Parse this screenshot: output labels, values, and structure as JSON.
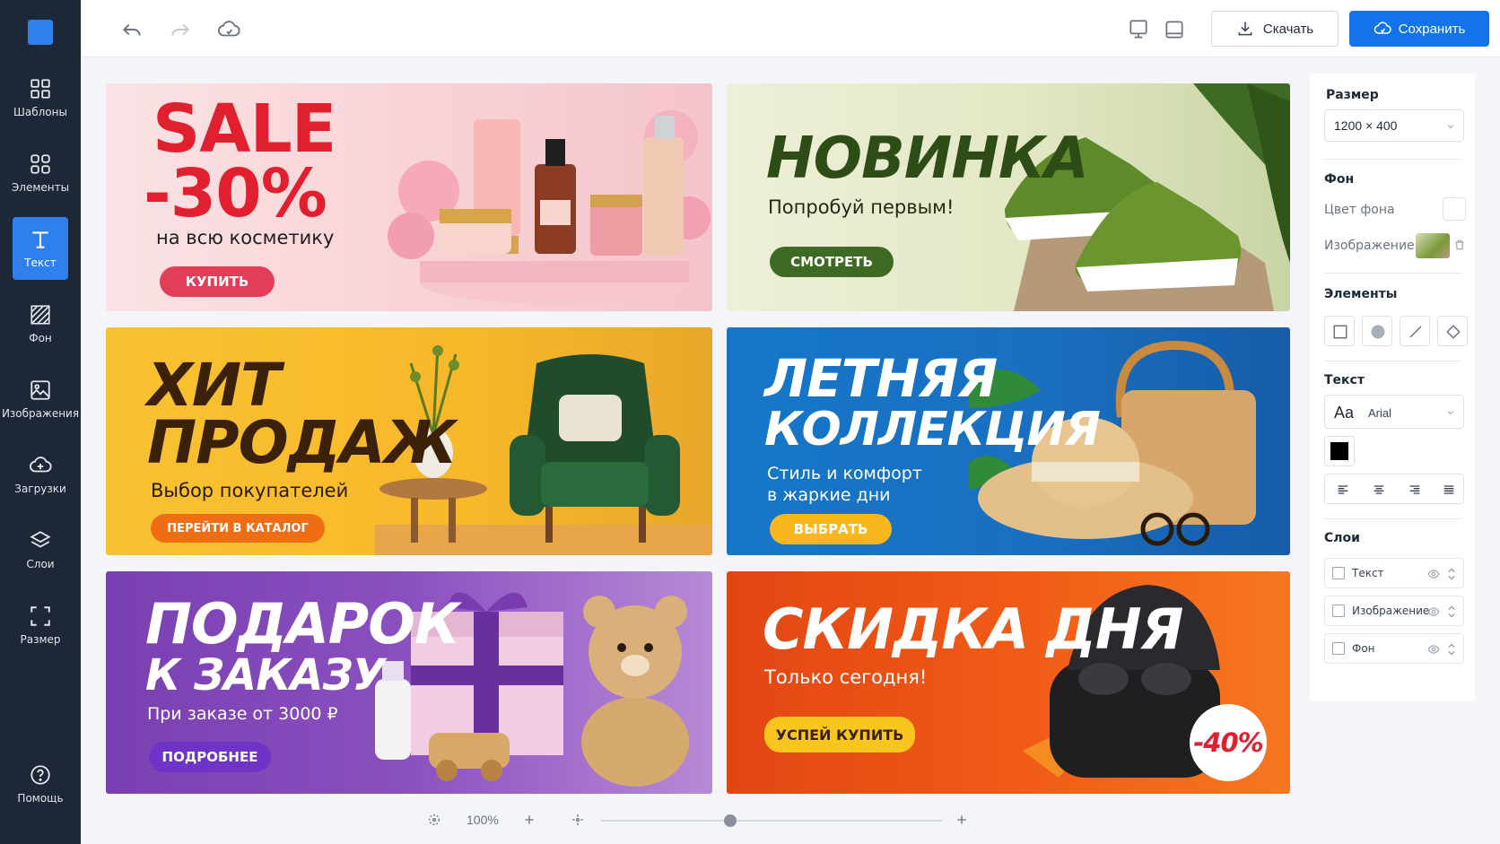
{
  "sidebar": {
    "items": [
      {
        "label": "Шаблоны",
        "icon": "grid-icon"
      },
      {
        "label": "Элементы",
        "icon": "shapes-icon"
      },
      {
        "label": "Текст",
        "icon": "text-icon"
      },
      {
        "label": "Фон",
        "icon": "background-icon"
      },
      {
        "label": "Изображения",
        "icon": "image-icon"
      },
      {
        "label": "Загрузки",
        "icon": "upload-icon"
      },
      {
        "label": "Слои",
        "icon": "layers-icon"
      },
      {
        "label": "Размер",
        "icon": "resize-icon"
      }
    ],
    "help": {
      "label": "Помощь",
      "icon": "help-icon"
    },
    "active_index": 2
  },
  "toolbar": {
    "download_label": "Скачать",
    "save_label": "Сохранить"
  },
  "banners": {
    "sale": {
      "title1": "SALE",
      "title2": "-30%",
      "subtitle": "на всю косметику",
      "button": "КУПИТЬ"
    },
    "new": {
      "title": "НОВИНКА",
      "subtitle": "Попробуй первым!",
      "button": "СМОТРЕТЬ"
    },
    "hit": {
      "title1": "ХИТ",
      "title2": "ПРОДАЖ",
      "subtitle": "Выбор покупателей",
      "button": "ПЕРЕЙТИ В КАТАЛОГ"
    },
    "summer": {
      "title1": "ЛЕТНЯЯ",
      "title2": "КОЛЛЕКЦИЯ",
      "subtitle1": "Стиль и комфорт",
      "subtitle2": "в жаркие дни",
      "button": "ВЫБРАТЬ"
    },
    "gift": {
      "title1": "ПОДАРОК",
      "title2": "К ЗАКАЗУ",
      "subtitle": "При заказе от 3000 ₽",
      "button": "ПОДРОБНЕЕ"
    },
    "deal": {
      "title": "СКИДКА ДНЯ",
      "subtitle": "Только сегодня!",
      "button": "УСПЕЙ КУПИТЬ",
      "badge": "-40%"
    }
  },
  "zoom": {
    "value": "100%",
    "level": 0.38
  },
  "panel": {
    "size": {
      "heading": "Размер",
      "value": "1200 × 400"
    },
    "background": {
      "heading": "Фон",
      "color_label": "Цвет фона",
      "image_label": "Изображение"
    },
    "elements": {
      "heading": "Элементы"
    },
    "text": {
      "heading": "Текст",
      "font_prefix": "Aa",
      "font": "Arial",
      "color": "#000000"
    },
    "layers": {
      "heading": "Слои",
      "items": [
        "Текст",
        "Изображение",
        "Фон"
      ]
    }
  },
  "colors": {
    "accent": "#1273eb",
    "sidebar": "#1d2735"
  }
}
